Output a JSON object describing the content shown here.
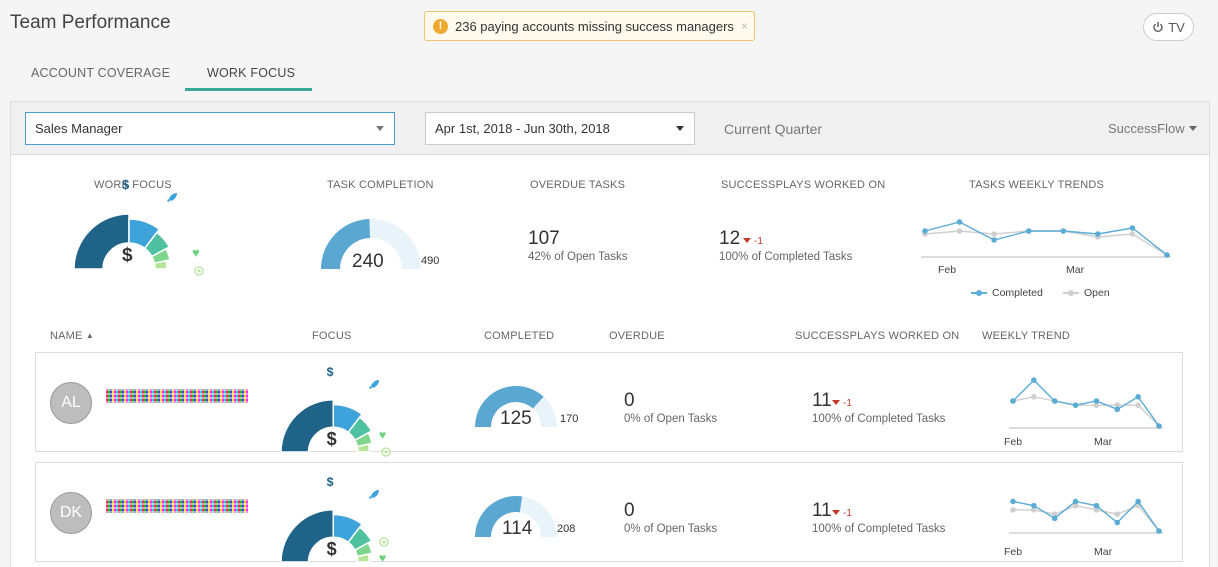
{
  "header": {
    "title": "Team Performance",
    "alert_icon": "!",
    "alert_text": "236 paying accounts missing success managers",
    "alert_close": "×",
    "tv_label": "TV"
  },
  "tabs": [
    {
      "label": "ACCOUNT COVERAGE",
      "active": false
    },
    {
      "label": "WORK FOCUS",
      "active": true
    }
  ],
  "filters": {
    "role": "Sales Manager",
    "date_range": "Apr 1st, 2018 - Jun 30th, 2018",
    "period": "Current Quarter",
    "flow": "SuccessFlow"
  },
  "summary": {
    "work_focus_label": "WORK FOCUS",
    "task_completion_label": "TASK COMPLETION",
    "task_completion_value": "240",
    "task_completion_max": "490",
    "overdue_label": "OVERDUE TASKS",
    "overdue_value": "107",
    "overdue_sub": "42% of Open Tasks",
    "plays_label": "SUCCESSPLAYS WORKED ON",
    "plays_value": "12",
    "plays_delta": "-1",
    "plays_sub": "100% of Completed Tasks",
    "trend_label": "TASKS WEEKLY TRENDS",
    "trend_x_labels": [
      "Feb",
      "Mar"
    ],
    "legend_completed": "Completed",
    "legend_open": "Open"
  },
  "columns": {
    "name": "NAME",
    "focus": "FOCUS",
    "completed": "COMPLETED",
    "overdue": "OVERDUE",
    "plays": "SUCCESSPLAYS WORKED ON",
    "trend": "WEEKLY TREND"
  },
  "rows": [
    {
      "initials": "AL",
      "completed": "125",
      "completed_max": "170",
      "overdue": "0",
      "overdue_sub": "0% of Open Tasks",
      "plays": "11",
      "plays_delta": "-1",
      "plays_sub": "100% of Completed Tasks",
      "trend_x_labels": [
        "Feb",
        "Mar"
      ]
    },
    {
      "initials": "DK",
      "completed": "114",
      "completed_max": "208",
      "overdue": "0",
      "overdue_sub": "0% of Open Tasks",
      "plays": "11",
      "plays_delta": "-1",
      "plays_sub": "100% of Completed Tasks",
      "trend_x_labels": [
        "Feb",
        "Mar"
      ]
    }
  ],
  "focus_legend_icons": [
    "dollar-icon",
    "rocket-icon",
    "heart-icon",
    "target-icon"
  ],
  "colors": {
    "focus_dark": "#1f6488",
    "focus_blue": "#3ea3db",
    "focus_teal": "#4fc1a0",
    "focus_green": "#7dd68c",
    "focus_light": "#b6e59a",
    "gauge_fill": "#5aa7d2",
    "gauge_track": "#e8f3fa",
    "trend_completed": "#5aacd5",
    "trend_open": "#cfcfcf",
    "tab_accent": "#3aa899"
  }
}
